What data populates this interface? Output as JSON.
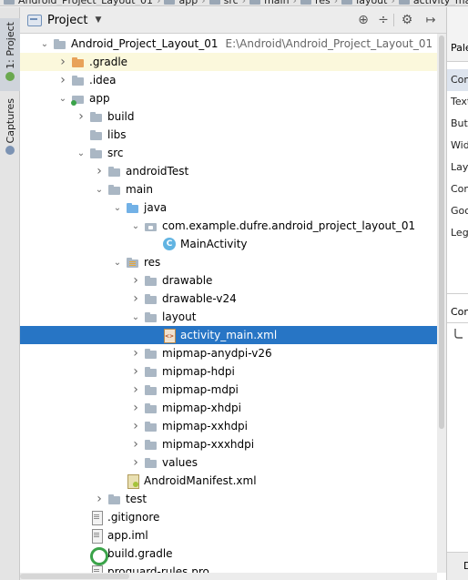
{
  "breadcrumb": [
    "Android_Project_Layout_01",
    "app",
    "src",
    "main",
    "res",
    "layout",
    "activity_main.xml"
  ],
  "left_strip": {
    "project_tab": "1: Project",
    "captures_tab": "Captures"
  },
  "panel": {
    "view_selector": "Project",
    "buttons": {
      "sync": "⊕",
      "collapse": "÷",
      "gear": "⚙",
      "hide": "↦"
    }
  },
  "tree": [
    {
      "label": "Android_Project_Layout_01",
      "path": "E:\\Android\\Android_Project_Layout_01",
      "depth": 0,
      "arrow": "open",
      "icon": "folder"
    },
    {
      "label": ".gradle",
      "depth": 1,
      "arrow": "closed",
      "icon": "folder-orange"
    },
    {
      "label": ".idea",
      "depth": 1,
      "arrow": "closed",
      "icon": "folder"
    },
    {
      "label": "app",
      "depth": 1,
      "arrow": "open",
      "icon": "module"
    },
    {
      "label": "build",
      "depth": 2,
      "arrow": "closed",
      "icon": "folder"
    },
    {
      "label": "libs",
      "depth": 2,
      "arrow": "none",
      "icon": "folder"
    },
    {
      "label": "src",
      "depth": 2,
      "arrow": "open",
      "icon": "folder"
    },
    {
      "label": "androidTest",
      "depth": 3,
      "arrow": "closed",
      "icon": "folder"
    },
    {
      "label": "main",
      "depth": 3,
      "arrow": "open",
      "icon": "folder"
    },
    {
      "label": "java",
      "depth": 4,
      "arrow": "open",
      "icon": "folder-blue"
    },
    {
      "label": "com.example.dufre.android_project_layout_01",
      "depth": 5,
      "arrow": "open",
      "icon": "pkg"
    },
    {
      "label": "MainActivity",
      "depth": 6,
      "arrow": "none",
      "icon": "cls"
    },
    {
      "label": "res",
      "depth": 4,
      "arrow": "open",
      "icon": "folder-res"
    },
    {
      "label": "drawable",
      "depth": 5,
      "arrow": "closed",
      "icon": "folder"
    },
    {
      "label": "drawable-v24",
      "depth": 5,
      "arrow": "closed",
      "icon": "folder"
    },
    {
      "label": "layout",
      "depth": 5,
      "arrow": "open",
      "icon": "folder"
    },
    {
      "label": "activity_main.xml",
      "depth": 6,
      "arrow": "none",
      "icon": "xml",
      "selected": true
    },
    {
      "label": "mipmap-anydpi-v26",
      "depth": 5,
      "arrow": "closed",
      "icon": "folder"
    },
    {
      "label": "mipmap-hdpi",
      "depth": 5,
      "arrow": "closed",
      "icon": "folder"
    },
    {
      "label": "mipmap-mdpi",
      "depth": 5,
      "arrow": "closed",
      "icon": "folder"
    },
    {
      "label": "mipmap-xhdpi",
      "depth": 5,
      "arrow": "closed",
      "icon": "folder"
    },
    {
      "label": "mipmap-xxhdpi",
      "depth": 5,
      "arrow": "closed",
      "icon": "folder"
    },
    {
      "label": "mipmap-xxxhdpi",
      "depth": 5,
      "arrow": "closed",
      "icon": "folder"
    },
    {
      "label": "values",
      "depth": 5,
      "arrow": "closed",
      "icon": "folder"
    },
    {
      "label": "AndroidManifest.xml",
      "depth": 4,
      "arrow": "none",
      "icon": "manifest"
    },
    {
      "label": "test",
      "depth": 3,
      "arrow": "closed",
      "icon": "folder"
    },
    {
      "label": ".gitignore",
      "depth": 2,
      "arrow": "none",
      "icon": "file"
    },
    {
      "label": "app.iml",
      "depth": 2,
      "arrow": "none",
      "icon": "file"
    },
    {
      "label": "build.gradle",
      "depth": 2,
      "arrow": "none",
      "icon": "gradle"
    },
    {
      "label": "proguard-rules.pro",
      "depth": 2,
      "arrow": "none",
      "icon": "file"
    }
  ],
  "palette": {
    "header": "Pale",
    "items": [
      "Com",
      "Text",
      "Butt",
      "Wid",
      "Layo",
      "Con",
      "Goo",
      "Lega"
    ],
    "component_tree": "Con",
    "bottom": "D"
  },
  "colors": {
    "selection": "#2775c5",
    "hover_row": "#fbf8dc"
  }
}
